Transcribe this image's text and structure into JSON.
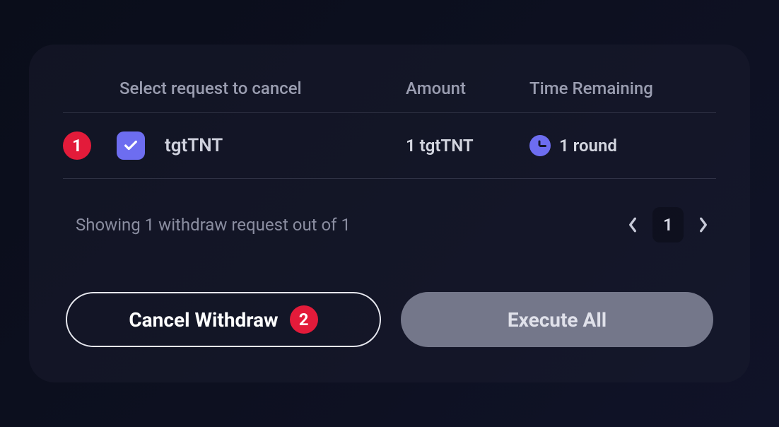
{
  "headers": {
    "select": "Select request to cancel",
    "amount": "Amount",
    "time": "Time Remaining"
  },
  "rows": [
    {
      "annotation": "1",
      "checked": true,
      "token": "tgtTNT",
      "amount": "1 tgtTNT",
      "time_remaining": "1 round"
    }
  ],
  "pager": {
    "status": "Showing 1 withdraw request out of 1",
    "page": "1"
  },
  "actions": {
    "cancel_label": "Cancel Withdraw",
    "cancel_annotation": "2",
    "execute_label": "Execute All"
  }
}
